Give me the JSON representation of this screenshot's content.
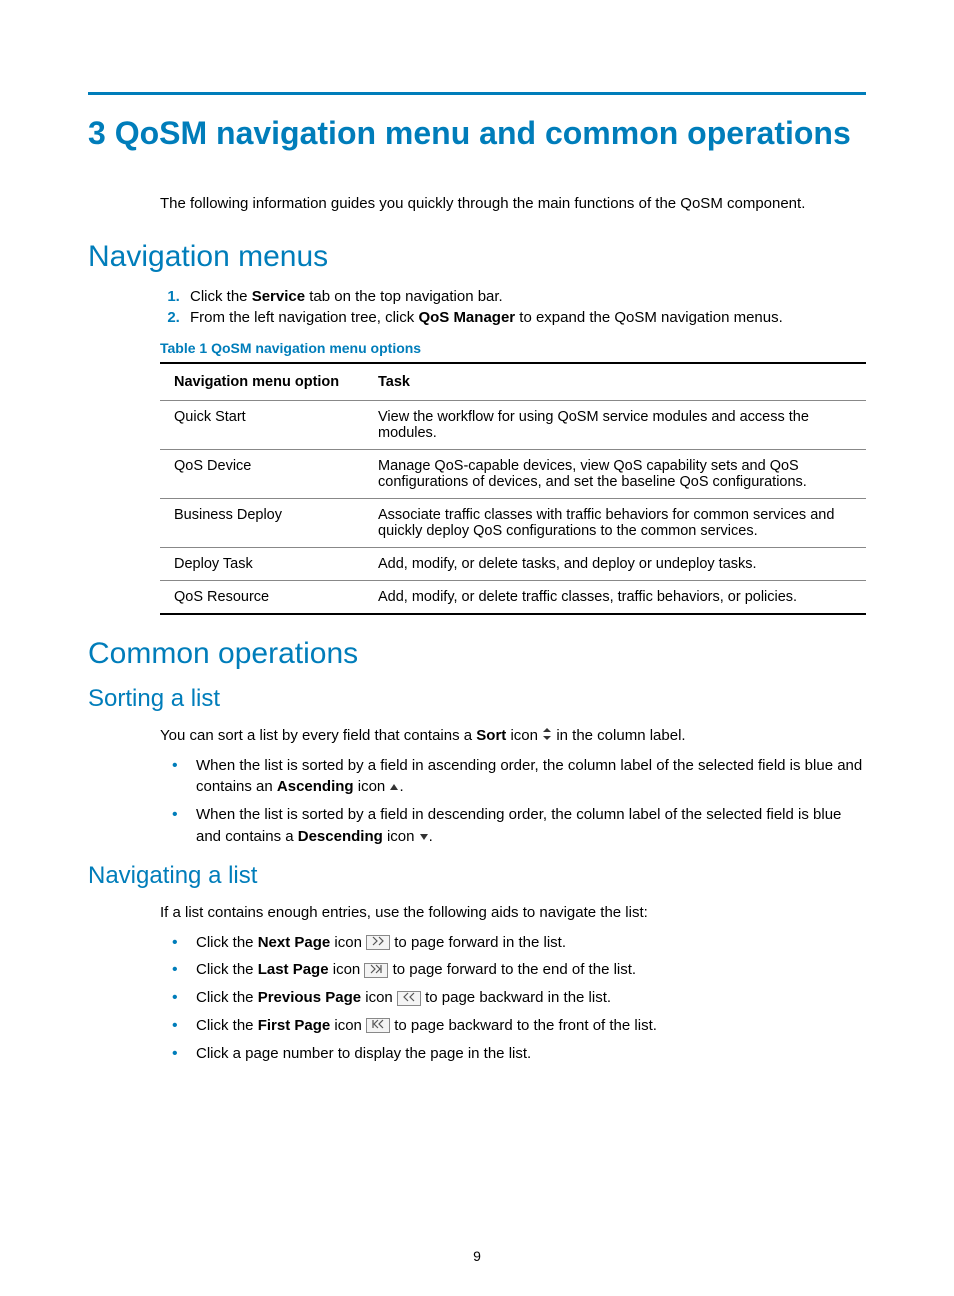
{
  "chapter_title": "3 QoSM navigation menu and common operations",
  "intro": "The following information guides you quickly through the main functions of the QoSM component.",
  "nav_section_title": "Navigation menus",
  "steps": {
    "s1_pre": "Click the ",
    "s1_bold": "Service",
    "s1_post": " tab on the top navigation bar.",
    "s2_pre": "From the left navigation tree, click ",
    "s2_bold": "QoS Manager",
    "s2_post": " to expand the QoSM navigation menus."
  },
  "table_caption": "Table 1 QoSM navigation menu options",
  "table": {
    "header_col1": "Navigation menu option",
    "header_col2": "Task",
    "rows": [
      {
        "opt": "Quick Start",
        "task": "View the workflow for using QoSM service modules and access the modules."
      },
      {
        "opt": "QoS Device",
        "task": "Manage QoS-capable devices, view QoS capability sets and QoS configurations of devices, and set the baseline QoS configurations."
      },
      {
        "opt": "Business Deploy",
        "task": "Associate traffic classes with traffic behaviors for common services and quickly deploy QoS configurations to the common services."
      },
      {
        "opt": "Deploy Task",
        "task": "Add, modify, or delete tasks, and deploy or undeploy tasks."
      },
      {
        "opt": "QoS Resource",
        "task": "Add, modify, or delete traffic classes, traffic behaviors, or policies."
      }
    ]
  },
  "common_ops_title": "Common operations",
  "sorting_title": "Sorting a list",
  "sorting_intro_pre": "You can sort a list by every field that contains a ",
  "sorting_intro_bold": "Sort",
  "sorting_intro_mid": " icon ",
  "sorting_intro_post": " in the column label.",
  "sort_bullets": {
    "b1_pre": "When the list is sorted by a field in ascending order, the column label of the selected field is blue and contains an ",
    "b1_bold": "Ascending",
    "b1_mid": " icon ",
    "b1_post": ".",
    "b2_pre": "When the list is sorted by a field in descending order, the column label of the selected field is blue and contains a ",
    "b2_bold": "Descending",
    "b2_mid": " icon ",
    "b2_post": "."
  },
  "navigating_title": "Navigating a list",
  "navigating_intro": "If a list contains enough entries, use the following aids to navigate the list:",
  "nav_bullets": {
    "b1_pre": "Click the ",
    "b1_bold": "Next Page",
    "b1_mid": " icon ",
    "b1_post": " to page forward in the list.",
    "b2_pre": "Click the ",
    "b2_bold": "Last Page",
    "b2_mid": " icon ",
    "b2_post": " to page forward to the end of the list.",
    "b3_pre": "Click the ",
    "b3_bold": "Previous Page",
    "b3_mid": " icon ",
    "b3_post": " to page backward in the list.",
    "b4_pre": "Click the ",
    "b4_bold": "First Page",
    "b4_mid": " icon ",
    "b4_post": " to page backward to the front of the list.",
    "b5": "Click a page number to display the page in the list."
  },
  "page_number": "9"
}
